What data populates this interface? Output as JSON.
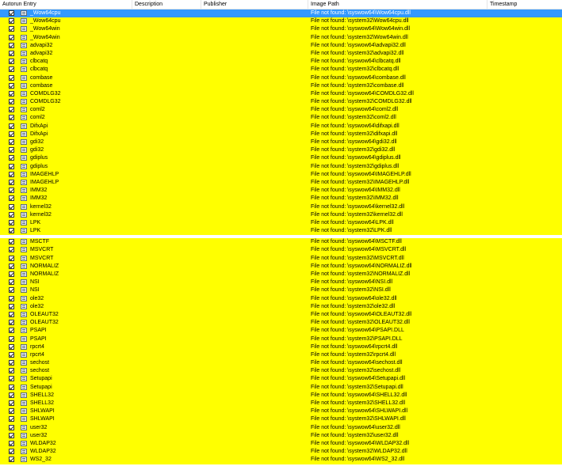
{
  "columns": {
    "autorun_entry": "Autorun Entry",
    "description": "Description",
    "publisher": "Publisher",
    "image_path": "Image Path",
    "timestamp": "Timestamp"
  },
  "colors": {
    "highlight": "#ffff00",
    "selected": "#3399ff"
  },
  "rows": [
    {
      "entry": "_Wow64cpu",
      "path": "File not found: \\syswow64\\Wow64cpu.dll",
      "selected": true
    },
    {
      "entry": "_Wow64cpu",
      "path": "File not found: \\system32\\Wow64cpu.dll"
    },
    {
      "entry": "_Wow64win",
      "path": "File not found: \\syswow64\\Wow64win.dll"
    },
    {
      "entry": "_Wow64win",
      "path": "File not found: \\system32\\Wow64win.dll"
    },
    {
      "entry": "advapi32",
      "path": "File not found: \\syswow64\\advapi32.dll"
    },
    {
      "entry": "advapi32",
      "path": "File not found: \\system32\\advapi32.dll"
    },
    {
      "entry": "clbcatq",
      "path": "File not found: \\syswow64\\clbcatq.dll"
    },
    {
      "entry": "clbcatq",
      "path": "File not found: \\system32\\clbcatq.dll"
    },
    {
      "entry": "combase",
      "path": "File not found: \\syswow64\\combase.dll"
    },
    {
      "entry": "combase",
      "path": "File not found: \\system32\\combase.dll"
    },
    {
      "entry": "COMDLG32",
      "path": "File not found: \\syswow64\\COMDLG32.dll"
    },
    {
      "entry": "COMDLG32",
      "path": "File not found: \\system32\\COMDLG32.dll"
    },
    {
      "entry": "coml2",
      "path": "File not found: \\syswow64\\coml2.dll"
    },
    {
      "entry": "coml2",
      "path": "File not found: \\system32\\coml2.dll"
    },
    {
      "entry": "DifxApi",
      "path": "File not found: \\syswow64\\difxapi.dll"
    },
    {
      "entry": "DifxApi",
      "path": "File not found: \\system32\\difxapi.dll"
    },
    {
      "entry": "gdi32",
      "path": "File not found: \\syswow64\\gdi32.dll"
    },
    {
      "entry": "gdi32",
      "path": "File not found: \\system32\\gdi32.dll"
    },
    {
      "entry": "gdiplus",
      "path": "File not found: \\syswow64\\gdiplus.dll"
    },
    {
      "entry": "gdiplus",
      "path": "File not found: \\system32\\gdiplus.dll"
    },
    {
      "entry": "IMAGEHLP",
      "path": "File not found: \\syswow64\\IMAGEHLP.dll"
    },
    {
      "entry": "IMAGEHLP",
      "path": "File not found: \\system32\\IMAGEHLP.dll"
    },
    {
      "entry": "IMM32",
      "path": "File not found: \\syswow64\\IMM32.dll"
    },
    {
      "entry": "IMM32",
      "path": "File not found: \\system32\\IMM32.dll"
    },
    {
      "entry": "kernel32",
      "path": "File not found: \\syswow64\\kernel32.dll"
    },
    {
      "entry": "kernel32",
      "path": "File not found: \\system32\\kernel32.dll"
    },
    {
      "entry": "LPK",
      "path": "File not found: \\syswow64\\LPK.dll"
    },
    {
      "entry": "LPK",
      "path": "File not found: \\system32\\LPK.dll"
    },
    {
      "entry": "MSCTF",
      "path": "File not found: \\syswow64\\MSCTF.dll",
      "gap_before": true
    },
    {
      "entry": "MSVCRT",
      "path": "File not found: \\syswow64\\MSVCRT.dll"
    },
    {
      "entry": "MSVCRT",
      "path": "File not found: \\system32\\MSVCRT.dll"
    },
    {
      "entry": "NORMALIZ",
      "path": "File not found: \\syswow64\\NORMALIZ.dll"
    },
    {
      "entry": "NORMALIZ",
      "path": "File not found: \\system32\\NORMALIZ.dll"
    },
    {
      "entry": "NSI",
      "path": "File not found: \\syswow64\\NSI.dll"
    },
    {
      "entry": "NSI",
      "path": "File not found: \\system32\\NSI.dll"
    },
    {
      "entry": "ole32",
      "path": "File not found: \\syswow64\\ole32.dll"
    },
    {
      "entry": "ole32",
      "path": "File not found: \\system32\\ole32.dll"
    },
    {
      "entry": "OLEAUT32",
      "path": "File not found: \\syswow64\\OLEAUT32.dll"
    },
    {
      "entry": "OLEAUT32",
      "path": "File not found: \\system32\\OLEAUT32.dll"
    },
    {
      "entry": "PSAPI",
      "path": "File not found: \\syswow64\\PSAPI.DLL"
    },
    {
      "entry": "PSAPI",
      "path": "File not found: \\system32\\PSAPI.DLL"
    },
    {
      "entry": "rpcrt4",
      "path": "File not found: \\syswow64\\rpcrt4.dll"
    },
    {
      "entry": "rpcrt4",
      "path": "File not found: \\system32\\rpcrt4.dll"
    },
    {
      "entry": "sechost",
      "path": "File not found: \\syswow64\\sechost.dll"
    },
    {
      "entry": "sechost",
      "path": "File not found: \\system32\\sechost.dll"
    },
    {
      "entry": "Setupapi",
      "path": "File not found: \\syswow64\\Setupapi.dll"
    },
    {
      "entry": "Setupapi",
      "path": "File not found: \\system32\\Setupapi.dll"
    },
    {
      "entry": "SHELL32",
      "path": "File not found: \\syswow64\\SHELL32.dll"
    },
    {
      "entry": "SHELL32",
      "path": "File not found: \\system32\\SHELL32.dll"
    },
    {
      "entry": "SHLWAPI",
      "path": "File not found: \\syswow64\\SHLWAPI.dll"
    },
    {
      "entry": "SHLWAPI",
      "path": "File not found: \\system32\\SHLWAPI.dll"
    },
    {
      "entry": "user32",
      "path": "File not found: \\syswow64\\user32.dll"
    },
    {
      "entry": "user32",
      "path": "File not found: \\system32\\user32.dll"
    },
    {
      "entry": "WLDAP32",
      "path": "File not found: \\syswow64\\WLDAP32.dll"
    },
    {
      "entry": "WLDAP32",
      "path": "File not found: \\system32\\WLDAP32.dll"
    },
    {
      "entry": "WS2_32",
      "path": "File not found: \\syswow64\\WS2_32.dll"
    }
  ]
}
